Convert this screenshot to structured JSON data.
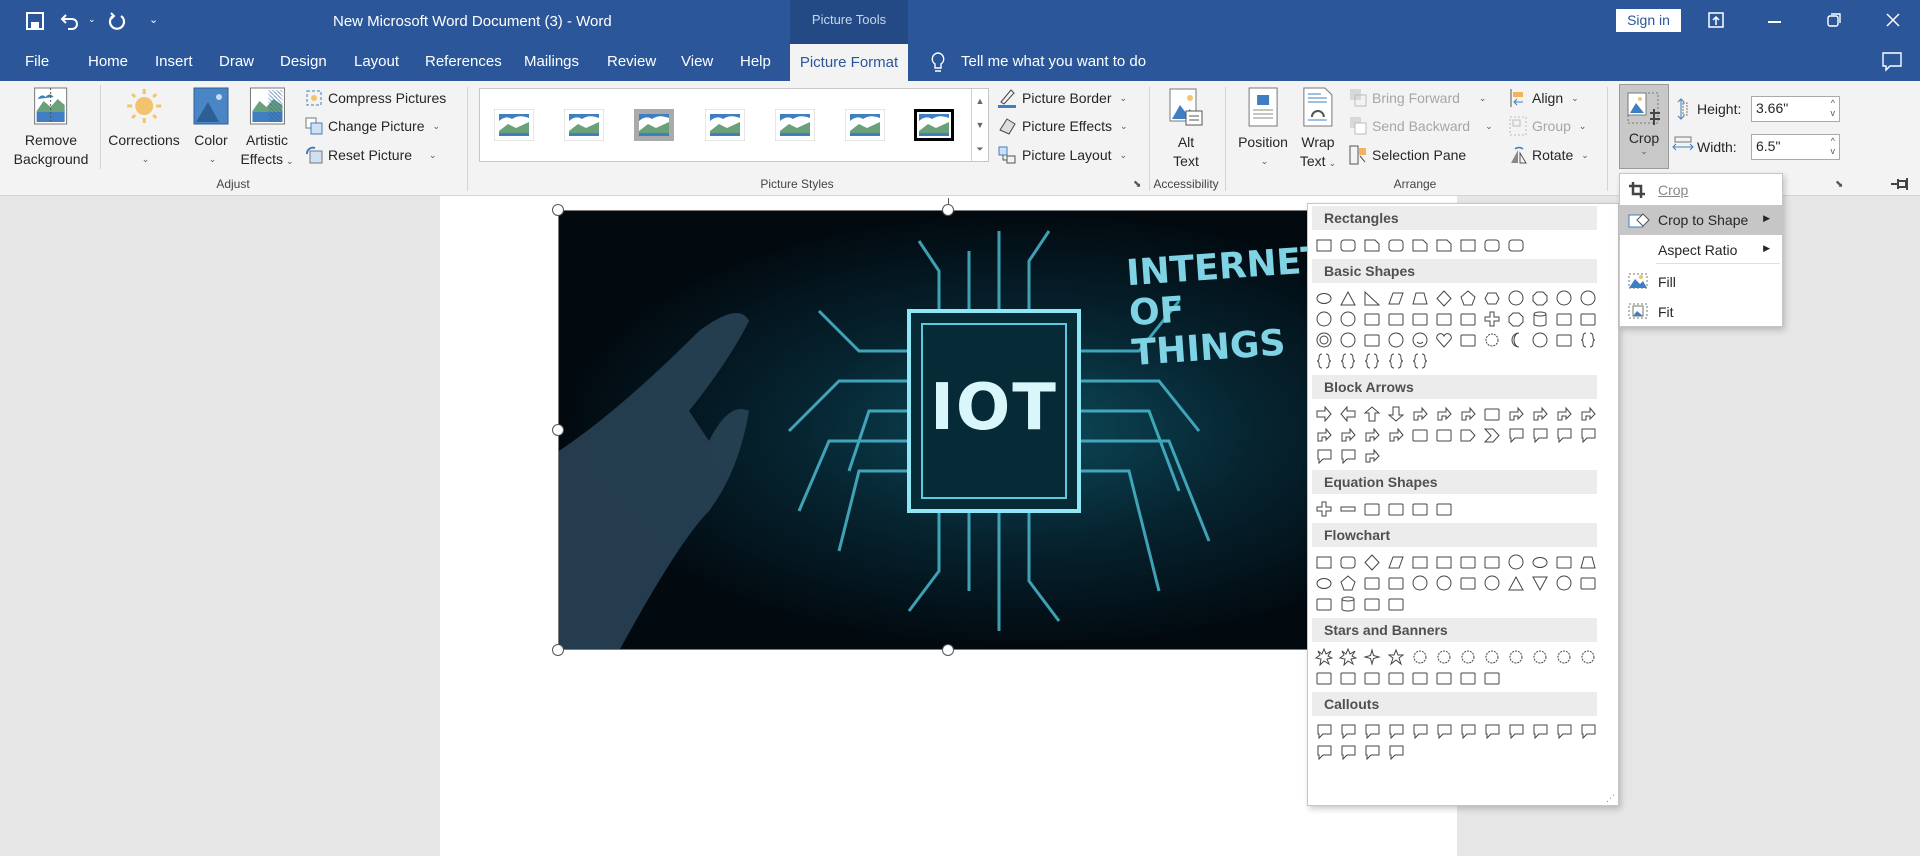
{
  "titlebar": {
    "title": "New Microsoft Word Document (3)  -  Word",
    "context_tab_group": "Picture Tools",
    "sign_in": "Sign in",
    "quick_access": [
      "save-icon",
      "undo-icon",
      "redo-icon",
      "customize-icon"
    ]
  },
  "tabs": [
    {
      "label": "File"
    },
    {
      "label": "Home"
    },
    {
      "label": "Insert"
    },
    {
      "label": "Draw"
    },
    {
      "label": "Design"
    },
    {
      "label": "Layout"
    },
    {
      "label": "References"
    },
    {
      "label": "Mailings"
    },
    {
      "label": "Review"
    },
    {
      "label": "View"
    },
    {
      "label": "Help"
    },
    {
      "label": "Picture Format",
      "active": true
    }
  ],
  "tell_me": "Tell me what you want to do",
  "ribbon": {
    "adjust": {
      "label": "Adjust",
      "remove_bg": [
        "Remove",
        "Background"
      ],
      "corrections": "Corrections",
      "color": "Color",
      "artistic": [
        "Artistic",
        "Effects"
      ],
      "compress": "Compress Pictures",
      "change": "Change Picture",
      "reset": "Reset Picture"
    },
    "styles": {
      "label": "Picture Styles",
      "border": "Picture Border",
      "effects": "Picture Effects",
      "layout": "Picture Layout"
    },
    "accessibility": {
      "label": "Accessibility",
      "alt": [
        "Alt",
        "Text"
      ]
    },
    "arrange": {
      "label": "Arrange",
      "position": "Position",
      "wrap": [
        "Wrap",
        "Text"
      ],
      "bring_forward": "Bring Forward",
      "send_backward": "Send Backward",
      "selection_pane": "Selection Pane",
      "align": "Align",
      "group": "Group",
      "rotate": "Rotate"
    },
    "size": {
      "crop": "Crop",
      "height_label": "Height:",
      "height": "3.66\"",
      "width_label": "Width:",
      "width": "6.5\""
    }
  },
  "picture": {
    "line1": "INTERNET",
    "line2": "OF THINGS",
    "chip": "IOT"
  },
  "crop_menu": [
    {
      "label": "Crop",
      "icon": "crop-icon"
    },
    {
      "label": "Crop to Shape",
      "icon": "crop-to-shape-icon",
      "submenu": true,
      "highlighted": true
    },
    {
      "label": "Aspect Ratio",
      "submenu": true
    },
    {
      "label": "Fill",
      "icon": "fill-icon"
    },
    {
      "label": "Fit",
      "icon": "fit-icon"
    }
  ],
  "shape_sections": [
    {
      "title": "Rectangles",
      "shapes": [
        "rect",
        "round",
        "snip",
        "round",
        "snip",
        "snip",
        "rect",
        "round",
        "round"
      ]
    },
    {
      "title": "Basic Shapes",
      "shapes": [
        "ellipse",
        "triangle",
        "rtriangle",
        "parallelogram",
        "trapezoid",
        "diamond",
        "pentagon",
        "hexagon",
        "heptagon",
        "octagon",
        "decagon",
        "dodecagon",
        "pie",
        "chord",
        "teardrop",
        "frame",
        "halfframe",
        "lshape",
        "diagstripe",
        "cross",
        "octagon",
        "can",
        "cube",
        "bevel",
        "donut",
        "nosymbol",
        "arc",
        "foldedcorner",
        "smiley",
        "heart",
        "lightning",
        "sun",
        "moon",
        "cloud",
        "arc",
        "bracketpair",
        "bracepair",
        "lbracket",
        "rbracket",
        "lbrace",
        "rbrace"
      ]
    },
    {
      "title": "Block Arrows",
      "shapes": [
        "rarrow",
        "larrow",
        "uarrow",
        "darrow",
        "lrarrow",
        "udarrow",
        "quadarrow",
        "lrupArrow",
        "bentarrow",
        "uturn",
        "leftup",
        "bentup",
        "curvedright",
        "curvedleft",
        "curvedup",
        "curveddown",
        "stripedright",
        "notchedright",
        "pentagonarrow",
        "chevron",
        "rightcallout",
        "downcallout",
        "leftcallout",
        "upcallout",
        "lrcallout",
        "quadcallout",
        "circulararrow"
      ]
    },
    {
      "title": "Equation Shapes",
      "shapes": [
        "plus",
        "minus",
        "multiply",
        "divide",
        "equal",
        "notequal"
      ]
    },
    {
      "title": "Flowchart",
      "shapes": [
        "rect",
        "round",
        "diamond",
        "parallelogram",
        "rect",
        "rect",
        "doc",
        "multidoc",
        "terminator",
        "ellipse",
        "manualinput",
        "trapezoid",
        "ellipse",
        "pentagon",
        "card",
        "tape",
        "sumjunction",
        "or",
        "collate",
        "sort",
        "triangle",
        "dtriangle",
        "storeddata",
        "delay",
        "sequential",
        "can",
        "directaccess",
        "display"
      ]
    },
    {
      "title": "Stars and Banners",
      "shapes": [
        "explosion",
        "explosion",
        "star4",
        "star5",
        "star6",
        "star7",
        "star8",
        "star10",
        "star12",
        "star16",
        "star24",
        "star32",
        "ribbon",
        "ribbon",
        "ribbon",
        "ribbon",
        "scroll",
        "scroll",
        "wave",
        "wave"
      ]
    },
    {
      "title": "Callouts",
      "shapes": [
        "rectcallout",
        "roundcallout",
        "ovalcallout",
        "cloudcallout",
        "linecallout",
        "linecallout",
        "linecallout",
        "linecallout",
        "linecallout",
        "linecallout",
        "linecallout",
        "linecallout",
        "linecallout",
        "linecallout",
        "linecallout",
        "linecallout"
      ]
    }
  ],
  "colors": {
    "titlebar": "#2b579a",
    "ribbon": "#f3f3f3",
    "highlight": "#c6c6c6"
  }
}
